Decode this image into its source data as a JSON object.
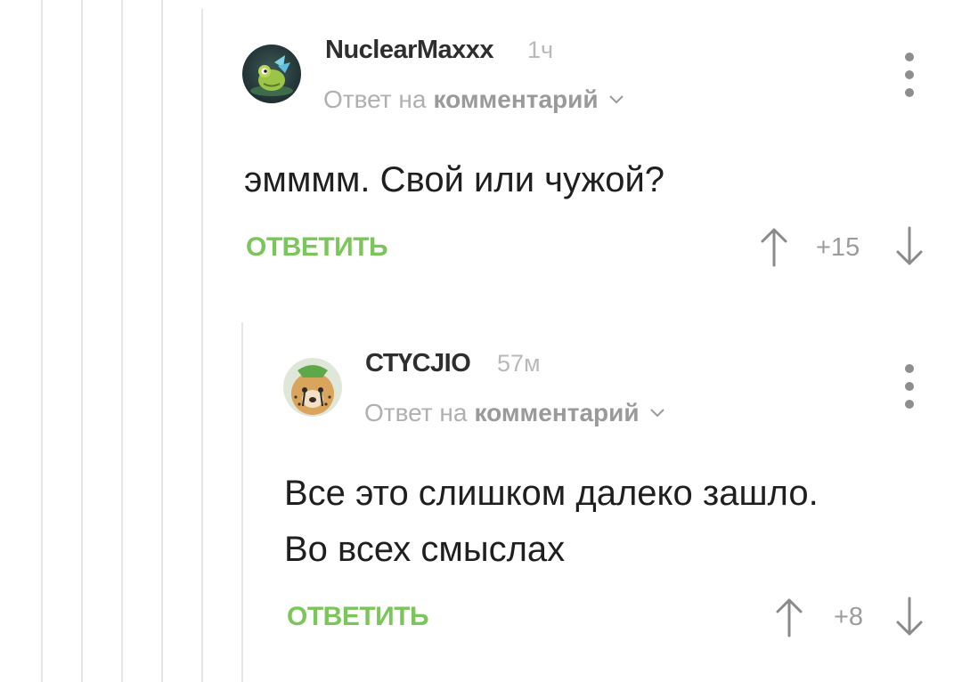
{
  "comments": [
    {
      "username": "NuclearMaxxx",
      "time": "1ч",
      "reply_prefix": "Ответ на",
      "reply_link": "комментарий",
      "text_lines": [
        "эмммм. Свой или чужой?"
      ],
      "reply_label": "ОТВЕТИТЬ",
      "score": "+15",
      "avatar_icon": "frog-avatar-icon"
    },
    {
      "username": "СТҮСJIO",
      "time": "57м",
      "reply_prefix": "Ответ на",
      "reply_link": "комментарий",
      "text_lines": [
        "Все это слишком далеко зашло.",
        "Во всех смыслах"
      ],
      "reply_label": "ОТВЕТИТЬ",
      "score": "+8",
      "avatar_icon": "cheetah-avatar-icon"
    }
  ],
  "colors": {
    "accent": "#7bc65a",
    "muted": "#b0b0b0",
    "thread_line": "#e6e6e6"
  }
}
